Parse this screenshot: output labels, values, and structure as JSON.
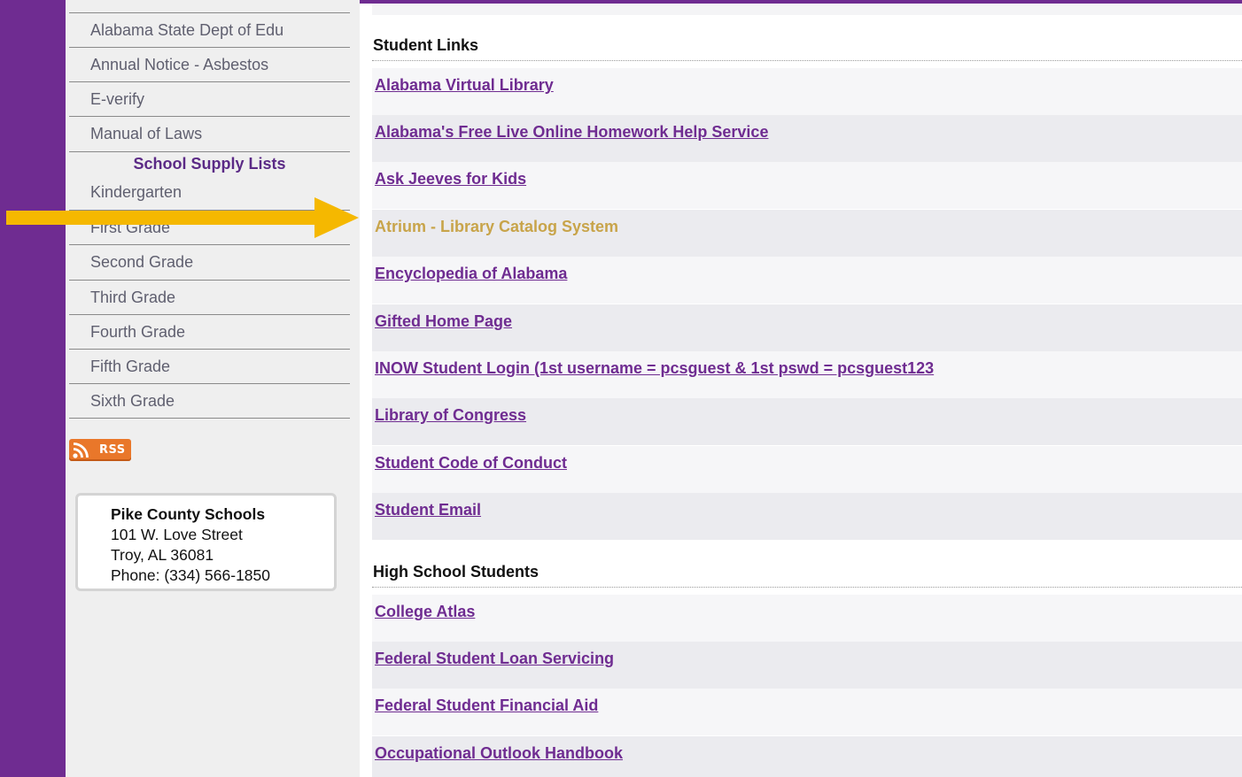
{
  "sidebar": {
    "nav_items": [
      {
        "label": "Alabama State Dept of Edu"
      },
      {
        "label": "Annual Notice - Asbestos"
      },
      {
        "label": "E-verify"
      },
      {
        "label": "Manual of Laws"
      }
    ],
    "supply_heading": "School Supply Lists",
    "grade_items": [
      {
        "label": "Kindergarten"
      },
      {
        "label": "First Grade"
      },
      {
        "label": "Second Grade"
      },
      {
        "label": "Third Grade"
      },
      {
        "label": "Fourth Grade"
      },
      {
        "label": "Fifth Grade"
      },
      {
        "label": "Sixth Grade"
      }
    ],
    "rss_label": "RSS",
    "address": {
      "org": "Pike County Schools",
      "street": "101 W. Love Street",
      "city": "Troy, AL 36081",
      "phone": "Phone: (334) 566-1850"
    }
  },
  "sections": [
    {
      "heading": "Student Links",
      "links": [
        {
          "label": "Alabama Virtual Library"
        },
        {
          "label": "Alabama's Free Live Online Homework Help Service"
        },
        {
          "label": "Ask Jeeves for Kids"
        },
        {
          "label": "Atrium - Library Catalog System",
          "hovered": true
        },
        {
          "label": "Encyclopedia of Alabama "
        },
        {
          "label": "Gifted Home Page"
        },
        {
          "label": "INOW Student Login (1st username = pcsguest & 1st pswd = pcsguest123"
        },
        {
          "label": "Library of Congress"
        },
        {
          "label": "Student Code of Conduct"
        },
        {
          "label": "Student Email"
        }
      ]
    },
    {
      "heading": "High School Students",
      "links": [
        {
          "label": "College Atlas"
        },
        {
          "label": "Federal Student Loan Servicing"
        },
        {
          "label": "Federal Student Financial Aid"
        },
        {
          "label": "Occupational Outlook Handbook"
        }
      ]
    }
  ],
  "colors": {
    "brand_purple": "#6f2c91",
    "link_hover": "#c8a44a",
    "annotation_arrow": "#f5b800"
  },
  "icons": {
    "rss": "rss-feed-icon",
    "arrow": "annotation-arrow-icon"
  }
}
